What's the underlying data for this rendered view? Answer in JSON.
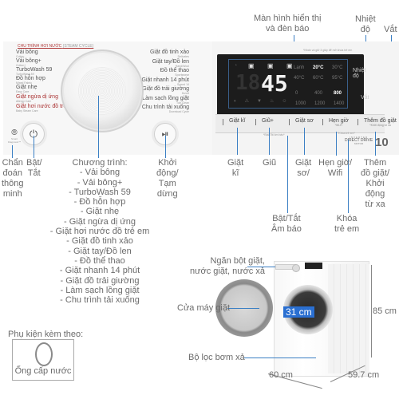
{
  "callouts_top": {
    "display": "Màn hình hiển thị\nvà đèn báo",
    "temperature": "Nhiệt\nđộ",
    "spin": "Vắt"
  },
  "control_panel": {
    "program_header": "CHU TRÌNH HƠI NƯỚC",
    "program_header_sub": "(STEAM CYCLE)",
    "programs_left": [
      {
        "label": "Vải bông",
        "sub": "Cotton"
      },
      {
        "label": "Vải bông+",
        "sub": "Cotton+"
      },
      {
        "label": "TurboWash 59",
        "sub": "TurboWash 59"
      },
      {
        "label": "Đồ hỗn hợp",
        "sub": "Mixed Fabric"
      },
      {
        "label": "Giặt nhẹ",
        "sub": "Easy Care"
      },
      {
        "label": "Giặt ngừa dị ứng",
        "sub": "Allergy Care"
      },
      {
        "label": "Giặt hơi nước đồ trẻ em",
        "sub": "Baby Steam Care"
      }
    ],
    "programs_right": [
      {
        "label": "Giặt đồ tinh xảo",
        "sub": "Delicates"
      },
      {
        "label": "Giặt tay/Đồ len",
        "sub": "Hand/Wool"
      },
      {
        "label": "Đồ thể thao",
        "sub": "Sportswear"
      },
      {
        "label": "Giặt nhanh 14 phút",
        "sub": "Speed 14"
      },
      {
        "label": "Giặt đồ trải giường",
        "sub": "Duvet"
      },
      {
        "label": "Làm sạch lồng giặt",
        "sub": "Tub Clean"
      },
      {
        "label": "Chu trình tải xuống",
        "sub": "Download Cycle"
      }
    ],
    "smart_diagnosis_label": "Smart Diagnosis™",
    "display": {
      "note": "*Nhấn và giữ 3 giây để mở khóa trẻ em",
      "time_digits": "45",
      "temp_options": [
        "Lạnh",
        "20°C",
        "30°C",
        "40°C",
        "60°C",
        "95°C"
      ],
      "temp_selected": "20°C",
      "spin_options": [
        "0",
        "400",
        "800",
        "1000",
        "1200",
        "1400"
      ],
      "spin_selected": "800",
      "side_temp": "Nhiệt độ",
      "side_spin": "Vắt"
    },
    "buttons": [
      {
        "label": "Giặt kĩ",
        "sub": ""
      },
      {
        "label": "Giũ+",
        "sub": ""
      },
      {
        "label": "Giặt sơ",
        "sub": ""
      },
      {
        "label": "Hẹn giờ",
        "sub": "*Wi-Fi"
      },
      {
        "label": "Thêm đồ giặt",
        "sub": "*Khởi động từ xa"
      }
    ],
    "note_sound": "*Bật/Tắt âm báo*",
    "note_childlock": "*Khóa trẻ em*",
    "inverter": "INVERTER",
    "direct_drive": "DIRECT DRIVE",
    "motor": "MOTOR",
    "capacity": "10"
  },
  "callouts_bottom": {
    "smart_diagnosis": "Chẩn\nđoán\nthông\nminh",
    "power": "Bật/\nTắt",
    "program_title": "Chương trình:",
    "program_list": [
      "- Vải bông",
      "- Vải bông+",
      "- TurboWash 59",
      "- Đồ hỗn hợp",
      "- Giặt nhẹ",
      "- Giặt ngừa dị ứng",
      "- Giặt hơi nước đồ trẻ em",
      "- Giặt đồ tinh xảo",
      "- Giặt tay/Đồ len",
      "- Đồ thể thao",
      "- Giặt nhanh 14 phút",
      "- Giặt đồ trải giường",
      "- Làm sạch lồng giặt",
      "- Chu trình tải xuống"
    ],
    "start_pause": "Khởi\nđộng/\nTạm\ndừng",
    "intensive": "Giặt\nkĩ",
    "rinse": "Giũ",
    "prewash": "Giặt\nsơ/",
    "timer_wifi": "Hẹn giờ/\nWifi",
    "add_item": "Thêm\nđồ giặt/\nKhởi\nđộng\ntừ xa",
    "sound": "Bật/Tắt\nÂm báo",
    "child_lock": "Khóa\ntrẻ em"
  },
  "machine": {
    "detergent_drawer": "Ngăn bột giặt,\nnước giặt, nước xả",
    "door": "Cửa máy giặt",
    "drain_filter": "Bộ lọc bơm xả",
    "door_diameter": "31 cm",
    "height": "85 cm",
    "width": "60 cm",
    "depth": "59.7 cm"
  },
  "accessories": {
    "title": "Phụ kiện kèm theo:",
    "items": [
      "Ống cấp nước"
    ]
  }
}
